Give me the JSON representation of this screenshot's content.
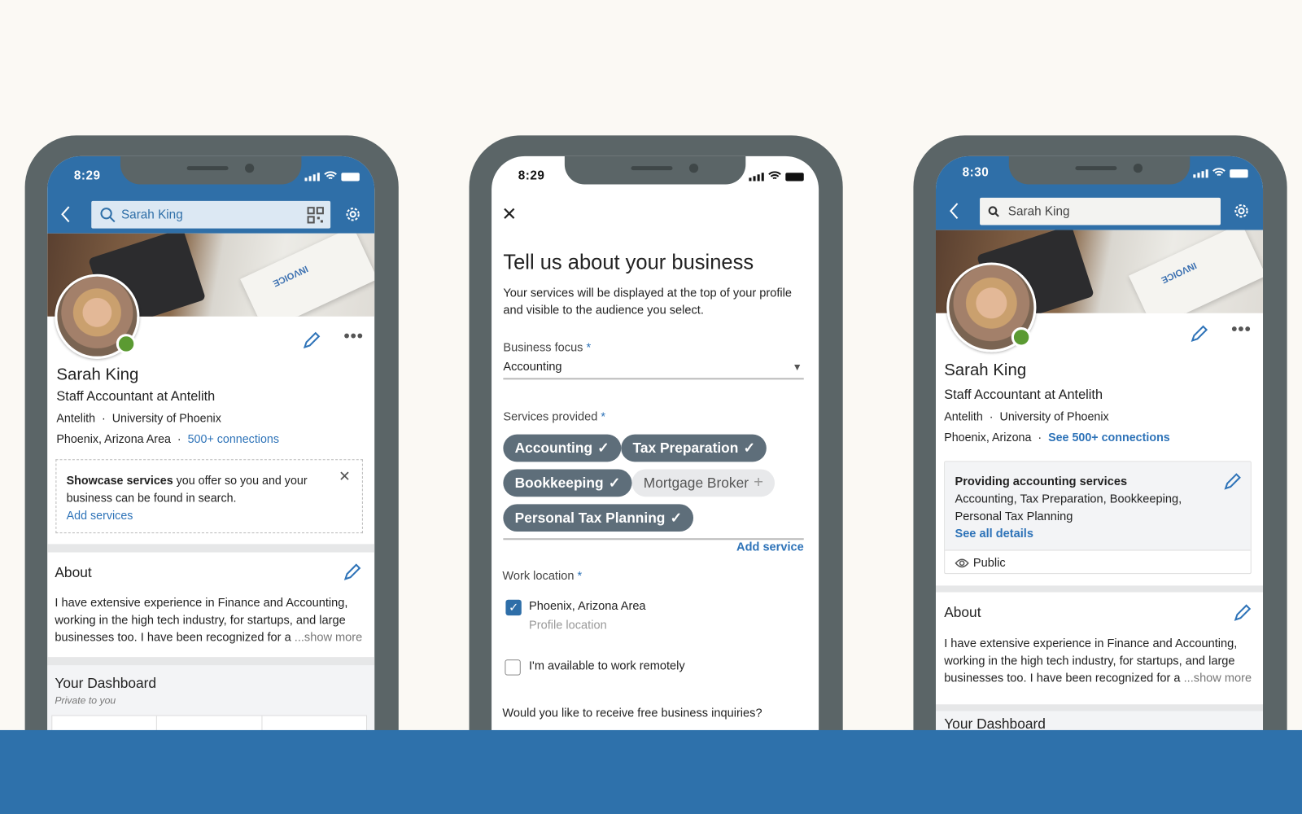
{
  "colors": {
    "brand_blue": "#2f6fa8",
    "link": "#2e73b8",
    "chip": "#5e6e7a",
    "online": "#5b9a32",
    "background": "#fbf9f4",
    "band": "#2e71ab"
  },
  "phone_left": {
    "status_time": "8:29",
    "search_value": "Sarah King",
    "icons": [
      "back-icon",
      "search-icon",
      "qr-code-icon",
      "gear-icon",
      "pencil-icon",
      "more-icon"
    ],
    "cover_text": "INVOICE",
    "name": "Sarah King",
    "headline": "Staff Accountant at Antelith",
    "company": "Antelith",
    "school": "University of Phoenix",
    "location": "Phoenix, Arizona Area",
    "connections": "500+ connections",
    "promo_bold": "Showcase services",
    "promo_rest": " you offer so you and your",
    "promo_line2": "business can be found in search.",
    "promo_link": "Add services",
    "about_title": "About",
    "about_lines": [
      "I have extensive experience in Finance and Accounting,",
      "working in the high tech industry, for startups, and large",
      "businesses too. I have been recognized for a"
    ],
    "show_more": "...show more",
    "dashboard_title": "Your Dashboard",
    "dashboard_sub": "Private to you"
  },
  "phone_middle": {
    "status_time": "8:29",
    "title": "Tell us about your business",
    "description": [
      "Your services will be displayed at the top of your profile",
      "and visible to the audience you select."
    ],
    "business_focus_label": "Business focus",
    "required": "*",
    "business_focus_value": "Accounting",
    "services_label": "Services provided",
    "chips": [
      {
        "label": "Accounting",
        "selected": true
      },
      {
        "label": "Tax Preparation",
        "selected": true
      },
      {
        "label": "Bookkeeping",
        "selected": true
      },
      {
        "label": "Mortgage Broker",
        "selected": false
      },
      {
        "label": "Personal Tax Planning",
        "selected": true
      }
    ],
    "add_service": "Add service",
    "work_location_label": "Work location",
    "location_option": "Phoenix, Arizona Area",
    "location_option_checked": true,
    "location_sub": "Profile location",
    "remote_option": "I'm available to work remotely",
    "remote_option_checked": false,
    "inquiries_question": "Would you like to receive free business inquiries?"
  },
  "phone_right": {
    "status_time": "8:30",
    "search_value": "Sarah King",
    "cover_text": "INVOICE",
    "name": "Sarah King",
    "headline": "Staff Accountant at Antelith",
    "company": "Antelith",
    "school": "University of Phoenix",
    "location": "Phoenix, Arizona",
    "connections": "See 500+ connections",
    "services_title": "Providing accounting services",
    "services_lines": [
      "Accounting, Tax Preparation, Bookkeeping,",
      "Personal Tax Planning"
    ],
    "see_all": "See all details",
    "visibility": "Public",
    "about_title": "About",
    "about_lines": [
      "I have extensive experience in Finance and Accounting,",
      "working in the high tech industry, for startups, and large",
      "businesses too. I have been recognized for a"
    ],
    "show_more": "...show more",
    "dashboard_title": "Your Dashboard"
  }
}
